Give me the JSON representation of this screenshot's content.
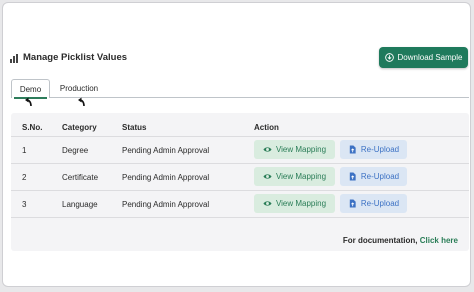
{
  "page": {
    "title": "Manage Picklist Values",
    "download_label": "Download Sample"
  },
  "tabs": [
    {
      "label": "Demo",
      "active": true
    },
    {
      "label": "Production",
      "active": false
    }
  ],
  "table": {
    "headers": [
      "S.No.",
      "Category",
      "Status",
      "Action"
    ],
    "rows": [
      {
        "sno": "1",
        "category": "Degree",
        "status": "Pending Admin Approval"
      },
      {
        "sno": "2",
        "category": "Certificate",
        "status": "Pending Admin Approval"
      },
      {
        "sno": "3",
        "category": "Language",
        "status": "Pending Admin Approval"
      }
    ],
    "view_label": "View Mapping",
    "upload_label": "Re-Upload"
  },
  "footer": {
    "doc_text": "For documentation,",
    "doc_link": "Click here"
  },
  "colors": {
    "primary": "#1f7a5c",
    "view_bg": "#d9ecdf",
    "upload_bg": "#dbe6f4",
    "upload_text": "#3d72c4"
  },
  "icons": {
    "header": "bar-chart-icon",
    "download": "download-icon",
    "view": "eye-icon",
    "upload": "file-upload-icon"
  }
}
